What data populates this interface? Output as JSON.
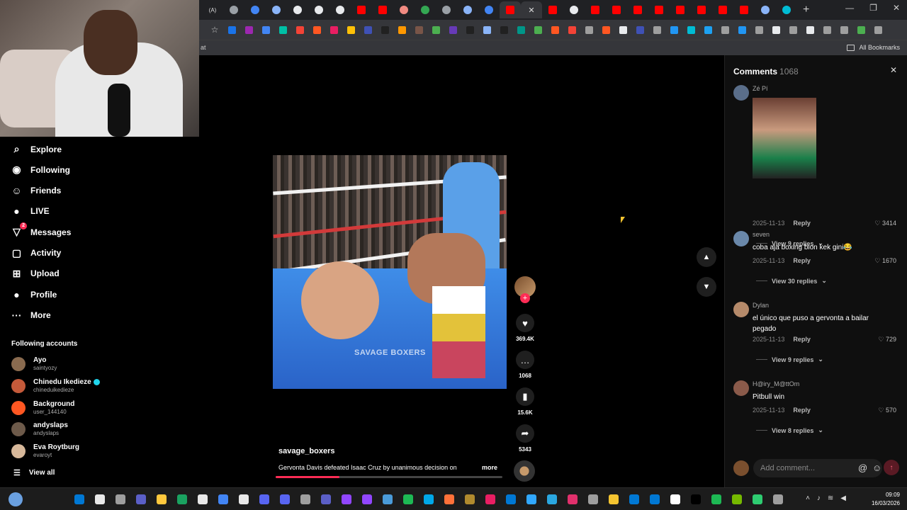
{
  "browser": {
    "tab_favicons": [
      "#9aa0a6",
      "#4285f4",
      "#8ab4f8",
      "#e8eaed",
      "#e8eaed",
      "#e8eaed",
      "#ff0000",
      "#ff0000",
      "#f28b82",
      "#34a853",
      "#9aa0a6",
      "#8ab4f8",
      "#4285f4",
      "#ff0000",
      "#ff0000",
      "#e8eaed",
      "#ff0000",
      "#ff0000",
      "#ff0000",
      "#ff0000",
      "#ff0000",
      "#ff0000",
      "#ff0000",
      "#ff0000",
      "#8ab4f8",
      "#00bcd4"
    ],
    "tab_label_first": "(A)",
    "active_tab_close": "✕",
    "new_tab": "+",
    "window_controls": [
      "—",
      "❐",
      "✕"
    ],
    "extension_colors": [
      "#1a73e8",
      "#9c27b0",
      "#4285f4",
      "#00bfa5",
      "#f44336",
      "#ff5722",
      "#e91e63",
      "#ffc107",
      "#3f51b5",
      "#212121",
      "#ff9800",
      "#795548",
      "#4caf50",
      "#673ab7",
      "#212121",
      "#8ab4f8",
      "#212121",
      "#009688",
      "#4caf50",
      "#ff5722",
      "#f44336",
      "#9e9e9e",
      "#ff5722",
      "#e8eaed",
      "#3f51b5",
      "#9e9e9e",
      "#2196f3",
      "#00bcd4",
      "#1da1f2",
      "#9e9e9e",
      "#2196f3",
      "#9e9e9e",
      "#e8eaed",
      "#9e9e9e",
      "#e8eaed",
      "#9e9e9e",
      "#9e9e9e",
      "#4caf50",
      "#9e9e9e"
    ],
    "bookmark_left": "at",
    "bookmark_right": "All Bookmarks"
  },
  "nav": {
    "items": [
      {
        "label": "Explore",
        "icon": "compass-icon",
        "glyph": "⌕"
      },
      {
        "label": "Following",
        "icon": "following-icon",
        "glyph": "◉"
      },
      {
        "label": "Friends",
        "icon": "friends-icon",
        "glyph": "☺"
      },
      {
        "label": "LIVE",
        "icon": "live-icon",
        "glyph": "●"
      },
      {
        "label": "Messages",
        "icon": "messages-icon",
        "glyph": "▽",
        "badge": "2"
      },
      {
        "label": "Activity",
        "icon": "activity-icon",
        "glyph": "▢"
      },
      {
        "label": "Upload",
        "icon": "upload-icon",
        "glyph": "⊞"
      },
      {
        "label": "Profile",
        "icon": "profile-icon",
        "glyph": "●"
      },
      {
        "label": "More",
        "icon": "more-icon",
        "glyph": "···"
      }
    ],
    "following_title": "Following accounts",
    "accounts": [
      {
        "name": "Ayo",
        "user": "saintyozy",
        "color": "#8a6b4f"
      },
      {
        "name": "Chinedu Ikedieze",
        "user": "chineduikedieze",
        "color": "#c45a3a",
        "verified": true
      },
      {
        "name": "Background",
        "user": "user_144140",
        "color": "#ff5722"
      },
      {
        "name": "andyslaps",
        "user": "andyslaps",
        "color": "#6d5a4a"
      },
      {
        "name": "Eva Roytburg",
        "user": "evaroyt",
        "color": "#d7b89a"
      }
    ],
    "view_all": "View all"
  },
  "video": {
    "watermark": "SAVAGE BOXERS",
    "username": "savage_boxers",
    "description": "Gervonta Davis defeated Isaac Cruz by unanimous decision on",
    "more": "more",
    "progress": 0.28,
    "likes": "369.4K",
    "comments": "1068",
    "saves": "15.6K",
    "shares": "5343"
  },
  "comments": {
    "title": "Comments",
    "count": "1068",
    "list": [
      {
        "name": "Zé Pí",
        "text": "",
        "date": "2025-11-13",
        "reply": "Reply",
        "likes": "3414",
        "view": "View 9 replies",
        "av": "#5a6e8a"
      },
      {
        "name": "seven",
        "text": "coba aja boxing bion kek gini😂",
        "date": "2025-11-13",
        "reply": "Reply",
        "likes": "1670",
        "view": "View 30 replies",
        "av": "#6a88aa"
      },
      {
        "name": "Dylan",
        "text": "el único que puso a gervonta a bailar pegado",
        "date": "2025-11-13",
        "reply": "Reply",
        "likes": "729",
        "view": "View 9 replies",
        "av": "#b58a6a"
      },
      {
        "name": "H@iry_M@ttOm",
        "text": "Pitbull win",
        "date": "2025-11-13",
        "reply": "Reply",
        "likes": "570",
        "view": "View 8 replies",
        "av": "#8a5a4a"
      }
    ],
    "input_placeholder": "Add comment..."
  },
  "taskbar": {
    "icon_colors": [
      "#0078d4",
      "#e8e8e8",
      "#9e9e9e",
      "#5b5fc7",
      "#ffc83d",
      "#1aa260",
      "#e8e8e8",
      "#4285f4",
      "#e8e8e8",
      "#5865f2",
      "#5865f2",
      "#9e9e9e",
      "#5b5fc7",
      "#9146ff",
      "#9146ff",
      "#4a9bd9",
      "#1db954",
      "#00a8e8",
      "#ff7139",
      "#b08a2e",
      "#e91e63",
      "#0078d4",
      "#31a8ff",
      "#2aa7e0",
      "#e1306c",
      "#9e9e9e",
      "#f4c430",
      "#0078d4",
      "#0078d4",
      "#ffffff",
      "#000000",
      "#1db954",
      "#76b900",
      "#2ecc71",
      "#9e9e9e"
    ],
    "time": "09:09",
    "date": "16/03/2026"
  }
}
